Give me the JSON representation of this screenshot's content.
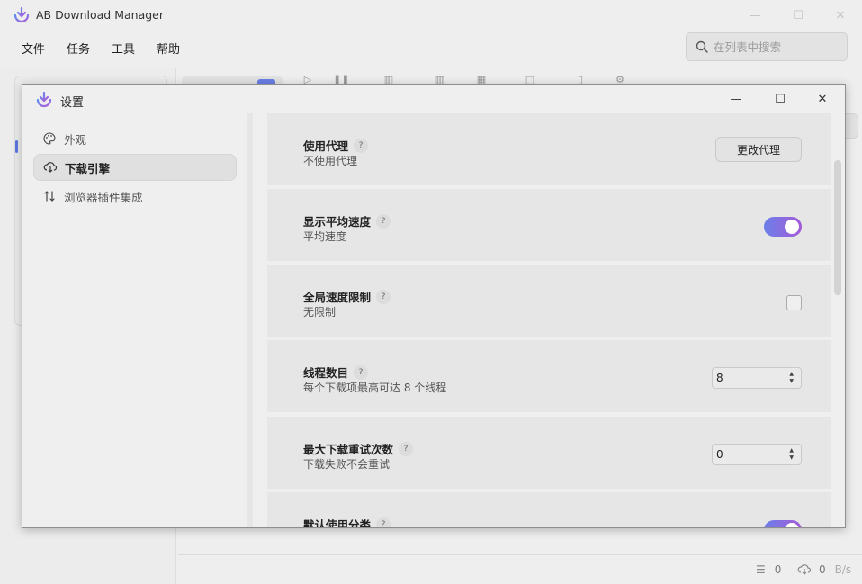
{
  "app": {
    "title": "AB Download Manager",
    "window_controls": [
      "—",
      "☐",
      "✕"
    ]
  },
  "menu": {
    "items": [
      "文件",
      "任务",
      "工具",
      "帮助"
    ]
  },
  "search": {
    "placeholder": "在列表中搜索",
    "icon": "search-icon"
  },
  "status": {
    "list_count": "0",
    "speed_value": "0",
    "speed_unit": "B/s"
  },
  "dialog": {
    "title": "设置",
    "controls": [
      "—",
      "☐",
      "✕"
    ],
    "nav": [
      {
        "label": "外观",
        "icon": "palette-icon",
        "active": false
      },
      {
        "label": "下载引擎",
        "icon": "cloud-download-icon",
        "active": true
      },
      {
        "label": "浏览器插件集成",
        "icon": "swap-vertical-icon",
        "active": false
      }
    ],
    "settings": [
      {
        "title": "使用代理",
        "desc": "不使用代理",
        "control": "button",
        "button_label": "更改代理"
      },
      {
        "title": "显示平均速度",
        "desc": "平均速度",
        "control": "toggle",
        "value": true
      },
      {
        "title": "全局速度限制",
        "desc": "无限制",
        "control": "checkbox",
        "value": false
      },
      {
        "title": "线程数目",
        "desc": "每个下载项最高可达 8 个线程",
        "control": "stepper",
        "value": "8"
      },
      {
        "title": "最大下载重试次数",
        "desc": "下载失败不会重试",
        "control": "stepper",
        "value": "0"
      },
      {
        "title": "默认使用分类",
        "desc": "",
        "control": "toggle",
        "value": true
      }
    ],
    "help_symbol": "?"
  },
  "colors": {
    "accent_start": "#6b7fe8",
    "accent_end": "#a45bd8"
  }
}
